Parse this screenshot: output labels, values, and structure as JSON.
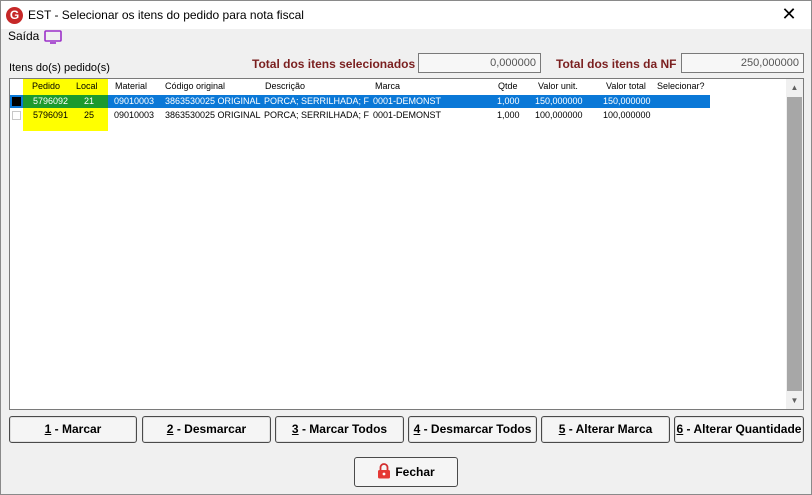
{
  "window": {
    "title": "EST - Selecionar os itens do pedido para nota fiscal",
    "logo_letter": "G",
    "close_glyph": "✕"
  },
  "menu": {
    "saida_label": "Saída",
    "saida_icon": "tv-icon"
  },
  "totals": {
    "selected_label": "Total dos itens selecionados",
    "selected_value": "0,000000",
    "nf_label": "Total dos itens da NF",
    "nf_value": "250,000000"
  },
  "grid": {
    "label": "Itens do(s) pedido(s)",
    "columns": [
      "Pedido",
      "Local",
      "Material",
      "Código original",
      "Descrição",
      "Marca",
      "Qtde",
      "Valor unit.",
      "Valor total",
      "Selecionar?"
    ],
    "rows": [
      {
        "pedido": "5796092",
        "local": "21",
        "material": "09010003",
        "codigo": "3863530025 ORIGINAL",
        "descricao": "PORCA; SERRILHADA; F",
        "marca": "0001-DEMONSTR",
        "qtde": "1,000",
        "valor_unit": "150,000000",
        "valor_total": "150,000000",
        "selecionar": "",
        "selected": true
      },
      {
        "pedido": "5796091",
        "local": "25",
        "material": "09010003",
        "codigo": "3863530025 ORIGINAL",
        "descricao": "PORCA; SERRILHADA; F",
        "marca": "0001-DEMONSTR",
        "qtde": "1,000",
        "valor_unit": "100,000000",
        "valor_total": "100,000000",
        "selecionar": "",
        "selected": false
      }
    ],
    "highlight_color": "#ffff00",
    "selection_color": "#0a78d7"
  },
  "buttons": {
    "marcar": {
      "key": "1",
      "label": " - Marcar"
    },
    "desmarcar": {
      "key": "2",
      "label": " - Desmarcar"
    },
    "marcar_todos": {
      "key": "3",
      "label": " - Marcar Todos"
    },
    "desmarcar_todos": {
      "key": "4",
      "label": " - Desmarcar Todos"
    },
    "alterar_marca": {
      "key": "5",
      "label": " - Alterar Marca"
    },
    "alterar_quantidade": {
      "key": "6",
      "label": " - Alterar Quantidade"
    },
    "fechar": {
      "key": "F",
      "label": "echar",
      "icon": "lock-icon"
    }
  },
  "colors": {
    "label_red": "#7a1f1f",
    "logo_red": "#c62828"
  }
}
